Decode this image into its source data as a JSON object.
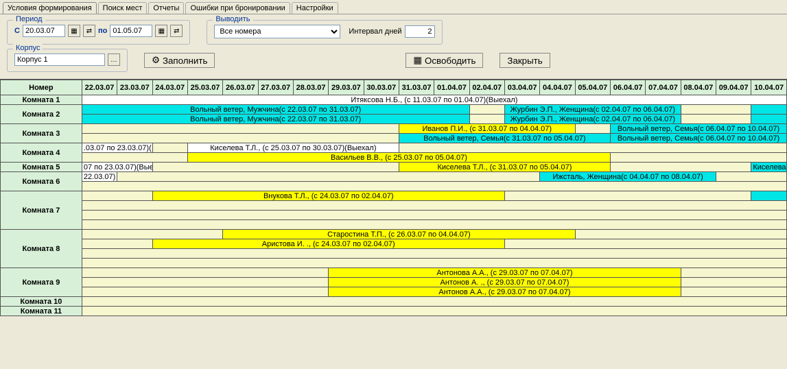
{
  "tabs": {
    "items": [
      "Условия формирования",
      "Поиск мест",
      "Отчеты",
      "Ошибки при бронировании",
      "Настройки"
    ],
    "active": 0
  },
  "period": {
    "legend": "Период",
    "from_label": "С",
    "from": "20.03.07",
    "to_label": "по",
    "to": "01.05.07"
  },
  "output": {
    "legend": "Выводить",
    "select": "Все номера",
    "interval_label": "Интервал дней",
    "interval": "2"
  },
  "build": {
    "legend": "Корпус",
    "value": "Корпус 1",
    "fill_btn": "Заполнить",
    "free_btn": "Освободить",
    "close_btn": "Закрыть"
  },
  "colors": {
    "header": "#d8f0d8",
    "empty": "#f6f6cf",
    "yellow": "#ffff00",
    "cyan": "#00e6e6"
  },
  "grid": {
    "room_header": "Номер",
    "dates": [
      "22.03.07",
      "23.03.07",
      "24.03.07",
      "25.03.07",
      "26.03.07",
      "27.03.07",
      "28.03.07",
      "29.03.07",
      "30.03.07",
      "31.03.07",
      "01.04.07",
      "02.04.07",
      "03.04.07",
      "04.04.07",
      "05.04.07",
      "06.04.07",
      "07.04.07",
      "08.04.07",
      "09.04.07",
      "10.04.07"
    ],
    "rooms": [
      {
        "label": "Комната 1",
        "rows": [
          {
            "cells": [
              "w",
              "w",
              "w",
              "w",
              "w",
              "w",
              "w",
              "w",
              "w",
              "w",
              "w",
              "w",
              "w",
              "w",
              "w",
              "w",
              "w",
              "w",
              "w",
              "w"
            ],
            "bars": [
              {
                "start": 0,
                "span": 20,
                "color": "w",
                "text": "Итяксова Н.Б., (с 11.03.07 по 01.04.07)(Выехал)"
              }
            ]
          }
        ]
      },
      {
        "label": "Комната 2",
        "rows": [
          {
            "bars": [
              {
                "start": 0,
                "span": 11,
                "color": "c",
                "text": "Вольный ветер, Мужчина(с 22.03.07 по 31.03.07)"
              },
              {
                "start": 11,
                "span": 1,
                "color": "e"
              },
              {
                "start": 12,
                "span": 5,
                "color": "c",
                "text": "Журбин Э.П., Женщина(с 02.04.07 по 06.04.07)"
              },
              {
                "start": 17,
                "span": 2,
                "color": "e"
              },
              {
                "start": 19,
                "span": 1,
                "color": "c",
                "text": ""
              }
            ]
          },
          {
            "bars": [
              {
                "start": 0,
                "span": 11,
                "color": "c",
                "text": "Вольный ветер, Мужчина(с 22.03.07 по 31.03.07)"
              },
              {
                "start": 11,
                "span": 1,
                "color": "e"
              },
              {
                "start": 12,
                "span": 5,
                "color": "c",
                "text": "Журбин Э.П., Женщина(с 02.04.07 по 06.04.07)"
              },
              {
                "start": 17,
                "span": 2,
                "color": "e"
              },
              {
                "start": 19,
                "span": 1,
                "color": "c",
                "text": ""
              }
            ]
          }
        ]
      },
      {
        "label": "Комната 3",
        "rows": [
          {
            "bars": [
              {
                "start": 0,
                "span": 9,
                "color": "e"
              },
              {
                "start": 9,
                "span": 5,
                "color": "y",
                "text": "Иванов П.И., (с 31.03.07 по 04.04.07)"
              },
              {
                "start": 14,
                "span": 1,
                "color": "e"
              },
              {
                "start": 15,
                "span": 5,
                "color": "c",
                "text": "Вольный ветер, Семья(с 06.04.07 по 10.04.07)"
              }
            ]
          },
          {
            "bars": [
              {
                "start": 0,
                "span": 9,
                "color": "e"
              },
              {
                "start": 9,
                "span": 6,
                "color": "c",
                "text": "Вольный ветер, Семья(с 31.03.07 по 05.04.07)"
              },
              {
                "start": 15,
                "span": 5,
                "color": "c",
                "text": "Вольный ветер, Семья(с 06.04.07 по 10.04.07)"
              }
            ]
          }
        ]
      },
      {
        "label": "Комната 4",
        "rows": [
          {
            "bars": [
              {
                "start": 0,
                "span": 2,
                "color": "w",
                "text": ".03.07 по 23.03.07)("
              },
              {
                "start": 2,
                "span": 1,
                "color": "e"
              },
              {
                "start": 3,
                "span": 6,
                "color": "w",
                "text": "Киселева Т.Л., (с 25.03.07 по 30.03.07)(Выехал)"
              },
              {
                "start": 9,
                "span": 11,
                "color": "e"
              }
            ]
          },
          {
            "bars": [
              {
                "start": 0,
                "span": 3,
                "color": "e"
              },
              {
                "start": 3,
                "span": 12,
                "color": "y",
                "text": "Васильев В.В., (с 25.03.07 по 05.04.07)"
              },
              {
                "start": 15,
                "span": 5,
                "color": "e"
              }
            ]
          }
        ]
      },
      {
        "label": "Комната 5",
        "rows": [
          {
            "bars": [
              {
                "start": 0,
                "span": 2,
                "color": "w",
                "text": "07 по 23.03.07)(Вые"
              },
              {
                "start": 2,
                "span": 7,
                "color": "e"
              },
              {
                "start": 9,
                "span": 6,
                "color": "y",
                "text": "Киселева Т.Л., (с 31.03.07 по 05.04.07)"
              },
              {
                "start": 15,
                "span": 4,
                "color": "e"
              },
              {
                "start": 19,
                "span": 1,
                "color": "c",
                "text": "Киселева"
              }
            ]
          }
        ]
      },
      {
        "label": "Комната 6",
        "rows": [
          {
            "bars": [
              {
                "start": 0,
                "span": 1,
                "color": "w",
                "text": "22.03.07)"
              },
              {
                "start": 1,
                "span": 12,
                "color": "e"
              },
              {
                "start": 13,
                "span": 5,
                "color": "c",
                "text": "Ижсталь, Женщина(с 04.04.07 по 08.04.07)"
              },
              {
                "start": 18,
                "span": 2,
                "color": "e"
              }
            ]
          },
          {
            "bars": [
              {
                "start": 0,
                "span": 20,
                "color": "e"
              }
            ]
          }
        ]
      },
      {
        "label": "Комната 7",
        "rows": [
          {
            "bars": [
              {
                "start": 0,
                "span": 2,
                "color": "e"
              },
              {
                "start": 2,
                "span": 10,
                "color": "y",
                "text": "Внукова Т.Л., (с 24.03.07 по 02.04.07)"
              },
              {
                "start": 12,
                "span": 7,
                "color": "e"
              },
              {
                "start": 19,
                "span": 1,
                "color": "c",
                "text": ""
              }
            ]
          },
          {
            "bars": [
              {
                "start": 0,
                "span": 20,
                "color": "e"
              }
            ]
          },
          {
            "bars": [
              {
                "start": 0,
                "span": 20,
                "color": "e"
              }
            ]
          },
          {
            "bars": [
              {
                "start": 0,
                "span": 20,
                "color": "e"
              }
            ]
          }
        ]
      },
      {
        "label": "Комната 8",
        "rows": [
          {
            "bars": [
              {
                "start": 0,
                "span": 4,
                "color": "e"
              },
              {
                "start": 4,
                "span": 10,
                "color": "y",
                "text": "Старостина Т.П., (с 26.03.07 по 04.04.07)"
              },
              {
                "start": 14,
                "span": 6,
                "color": "e"
              }
            ]
          },
          {
            "bars": [
              {
                "start": 0,
                "span": 2,
                "color": "e"
              },
              {
                "start": 2,
                "span": 10,
                "color": "y",
                "text": "Аристова И. ., (с 24.03.07 по 02.04.07)"
              },
              {
                "start": 12,
                "span": 8,
                "color": "e"
              }
            ]
          },
          {
            "bars": [
              {
                "start": 0,
                "span": 20,
                "color": "e"
              }
            ]
          },
          {
            "bars": [
              {
                "start": 0,
                "span": 20,
                "color": "e"
              }
            ]
          }
        ]
      },
      {
        "label": "Комната 9",
        "rows": [
          {
            "bars": [
              {
                "start": 0,
                "span": 7,
                "color": "e"
              },
              {
                "start": 7,
                "span": 10,
                "color": "y",
                "text": "Антонова А.А., (с 29.03.07 по 07.04.07)"
              },
              {
                "start": 17,
                "span": 3,
                "color": "e"
              }
            ]
          },
          {
            "bars": [
              {
                "start": 0,
                "span": 7,
                "color": "e"
              },
              {
                "start": 7,
                "span": 10,
                "color": "y",
                "text": "Антонов А. ., (с 29.03.07 по 07.04.07)"
              },
              {
                "start": 17,
                "span": 3,
                "color": "e"
              }
            ]
          },
          {
            "bars": [
              {
                "start": 0,
                "span": 7,
                "color": "e"
              },
              {
                "start": 7,
                "span": 10,
                "color": "y",
                "text": "Антонов А.А., (с 29.03.07 по 07.04.07)"
              },
              {
                "start": 17,
                "span": 3,
                "color": "e"
              }
            ]
          }
        ]
      },
      {
        "label": "Комната 10",
        "rows": [
          {
            "bars": [
              {
                "start": 0,
                "span": 20,
                "color": "e"
              }
            ]
          }
        ]
      },
      {
        "label": "Комната 11",
        "rows": [
          {
            "bars": [
              {
                "start": 0,
                "span": 20,
                "color": "e"
              }
            ]
          }
        ]
      }
    ]
  }
}
